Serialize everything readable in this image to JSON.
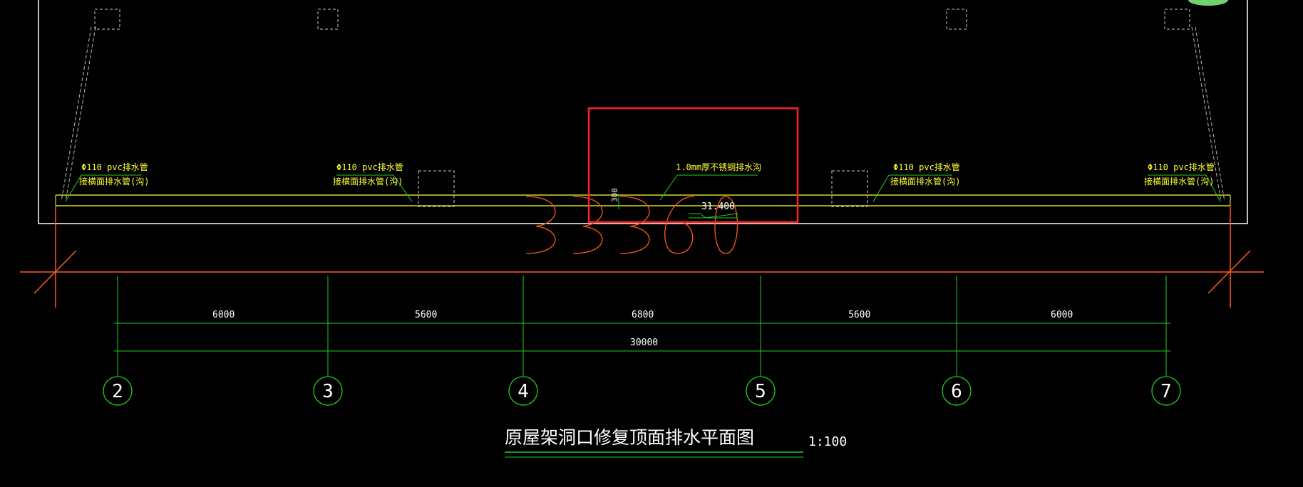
{
  "drawing": {
    "title": "原屋架洞口修复顶面排水平面图",
    "scale": "1:100",
    "annotations": {
      "pipe_label_line1": "Φ110 pvc排水管",
      "pipe_label_line2": "接横面排水管(沟)",
      "gutter_label": "1.0mm厚不锈钢排水沟",
      "width_label": "300",
      "elevation_label": "31.400"
    },
    "dimensions": {
      "spans": [
        "6000",
        "5600",
        "6800",
        "5600",
        "6000"
      ],
      "total": "30000"
    },
    "axes": [
      "2",
      "3",
      "4",
      "5",
      "6",
      "7"
    ],
    "colors": {
      "background": "#000000",
      "outline": "#ffffff",
      "dimension_lines": "#22cc22",
      "annotation_text": "#ffff33",
      "red_frame": "#ff2222",
      "orange_axis": "#ff5a1f"
    }
  }
}
